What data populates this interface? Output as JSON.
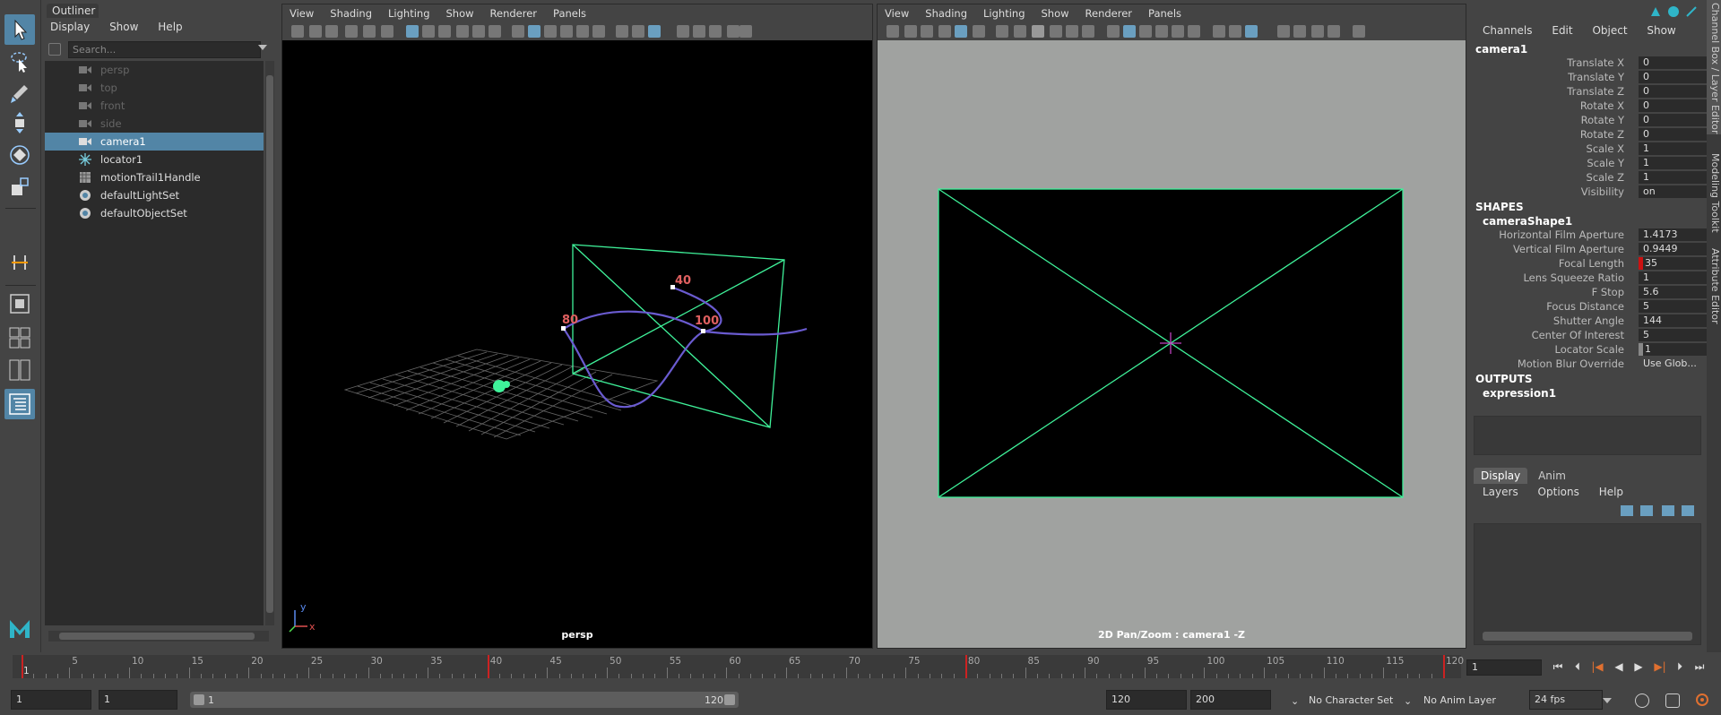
{
  "outliner": {
    "tab": "Outliner",
    "menus": [
      "Display",
      "Show",
      "Help"
    ],
    "search_placeholder": "Search...",
    "items": [
      {
        "label": "persp",
        "icon": "camera-icon",
        "state": "dim"
      },
      {
        "label": "top",
        "icon": "camera-icon",
        "state": "dim"
      },
      {
        "label": "front",
        "icon": "camera-icon",
        "state": "dim"
      },
      {
        "label": "side",
        "icon": "camera-icon",
        "state": "dim"
      },
      {
        "label": "camera1",
        "icon": "camera-icon",
        "state": "selected"
      },
      {
        "label": "locator1",
        "icon": "locator-icon",
        "state": "normal"
      },
      {
        "label": "motionTrail1Handle",
        "icon": "motion-trail-icon",
        "state": "normal"
      },
      {
        "label": "defaultLightSet",
        "icon": "set-icon",
        "state": "normal"
      },
      {
        "label": "defaultObjectSet",
        "icon": "set-icon",
        "state": "normal"
      }
    ]
  },
  "viewport_menus": [
    "View",
    "Shading",
    "Lighting",
    "Show",
    "Renderer",
    "Panels"
  ],
  "viewport1": {
    "label": "persp",
    "trail_labels": [
      "40",
      "80",
      "100"
    ],
    "axis_labels": [
      "y",
      "x"
    ]
  },
  "viewport2": {
    "label": "2D Pan/Zoom : camera1 -Z"
  },
  "channel_box": {
    "menus": [
      "Channels",
      "Edit",
      "Object",
      "Show"
    ],
    "node": "camera1",
    "transform_attrs": [
      {
        "name": "Translate X",
        "value": "0"
      },
      {
        "name": "Translate Y",
        "value": "0"
      },
      {
        "name": "Translate Z",
        "value": "0"
      },
      {
        "name": "Rotate X",
        "value": "0"
      },
      {
        "name": "Rotate Y",
        "value": "0"
      },
      {
        "name": "Rotate Z",
        "value": "0"
      },
      {
        "name": "Scale X",
        "value": "1"
      },
      {
        "name": "Scale Y",
        "value": "1"
      },
      {
        "name": "Scale Z",
        "value": "1"
      },
      {
        "name": "Visibility",
        "value": "on"
      }
    ],
    "shapes_header": "SHAPES",
    "shape_node": "cameraShape1",
    "shape_attrs": [
      {
        "name": "Horizontal Film Aperture",
        "value": "1.4173",
        "mark": ""
      },
      {
        "name": "Vertical Film Aperture",
        "value": "0.9449",
        "mark": ""
      },
      {
        "name": "Focal Length",
        "value": "35",
        "mark": "red"
      },
      {
        "name": "Lens Squeeze Ratio",
        "value": "1",
        "mark": ""
      },
      {
        "name": "F Stop",
        "value": "5.6",
        "mark": ""
      },
      {
        "name": "Focus Distance",
        "value": "5",
        "mark": ""
      },
      {
        "name": "Shutter Angle",
        "value": "144",
        "mark": ""
      },
      {
        "name": "Center Of Interest",
        "value": "5",
        "mark": ""
      },
      {
        "name": "Locator Scale",
        "value": "1",
        "mark": "gray"
      },
      {
        "name": "Motion Blur Override",
        "value": "Use Glob...",
        "mark": "plain"
      }
    ],
    "outputs_header": "OUTPUTS",
    "output_node": "expression1"
  },
  "layer_editor": {
    "tabs": [
      "Display",
      "Anim"
    ],
    "menus": [
      "Layers",
      "Options",
      "Help"
    ]
  },
  "side_tabs": [
    "Channel Box / Layer Editor",
    "Modeling Toolkit",
    "Attribute Editor"
  ],
  "timeline": {
    "ticks": [
      "5",
      "10",
      "15",
      "20",
      "25",
      "30",
      "35",
      "40",
      "45",
      "50",
      "55",
      "60",
      "65",
      "70",
      "75",
      "80",
      "85",
      "90",
      "95",
      "100",
      "105",
      "110",
      "115",
      "120"
    ],
    "start_label": "1",
    "keys": [
      1,
      40,
      80,
      120
    ],
    "current_frame": "1"
  },
  "range": {
    "start": "1",
    "playback_start": "1",
    "slider_start": "1",
    "slider_end": "120",
    "playback_end": "120",
    "end": "200",
    "character_set": "No Character Set",
    "anim_layer": "No Anim Layer",
    "fps": "24 fps"
  },
  "colors": {
    "selection": "#5285a6",
    "camera_wire": "#3ff29a",
    "trail": "#6a5bd0",
    "key": "#c22"
  }
}
